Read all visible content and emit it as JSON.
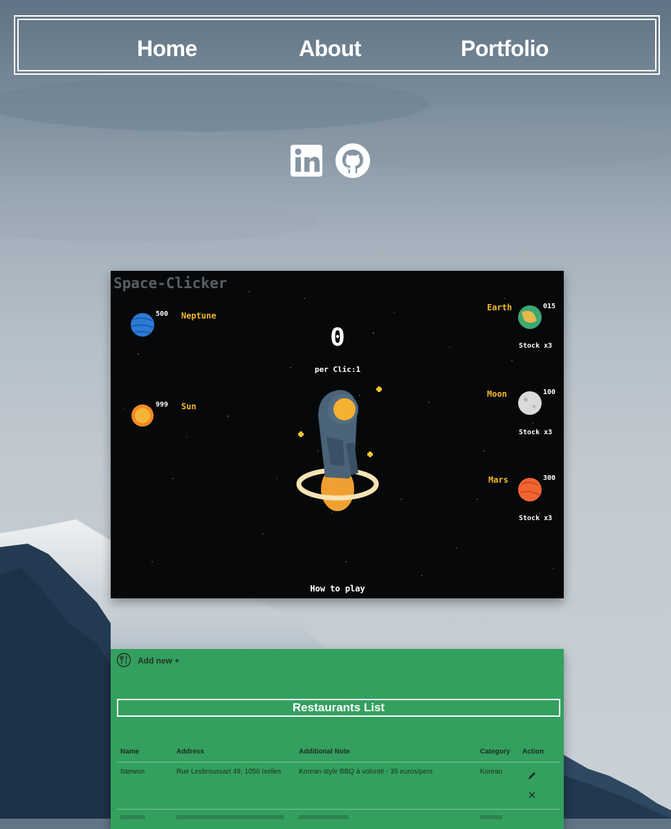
{
  "nav": {
    "items": [
      "Home",
      "About",
      "Portfolio"
    ]
  },
  "social": {
    "icons": [
      "linkedin-icon",
      "github-icon"
    ]
  },
  "projects": {
    "space_clicker": {
      "title": "Space-Clicker",
      "counter": "0",
      "per_click": "per Clic:1",
      "how_to_play": "How to play",
      "left_items": [
        {
          "price": "500",
          "name": "Neptune"
        },
        {
          "price": "999",
          "name": "Sun"
        }
      ],
      "right_items": [
        {
          "name": "Earth",
          "price": "015",
          "stock": "Stock x3"
        },
        {
          "name": "Moon",
          "price": "100",
          "stock": "Stock x3"
        },
        {
          "name": "Mars",
          "price": "300",
          "stock": "Stock x3"
        }
      ]
    },
    "restaurants": {
      "add_new": "Add new +",
      "title": "Restaurants List",
      "columns": [
        "Name",
        "Address",
        "Additional Note",
        "Category",
        "Action"
      ],
      "rows": [
        {
          "name": "Itaewon",
          "address": "Rue Lesbroussart 49, 1050 Ixelles",
          "note": "Korean-style BBQ à volonté - 35 euros/pers",
          "category": "Korean"
        }
      ]
    }
  },
  "colors": {
    "nav_text": "#ffffff",
    "space_accent": "#f0b72a",
    "resto_green": "#33a05f"
  }
}
